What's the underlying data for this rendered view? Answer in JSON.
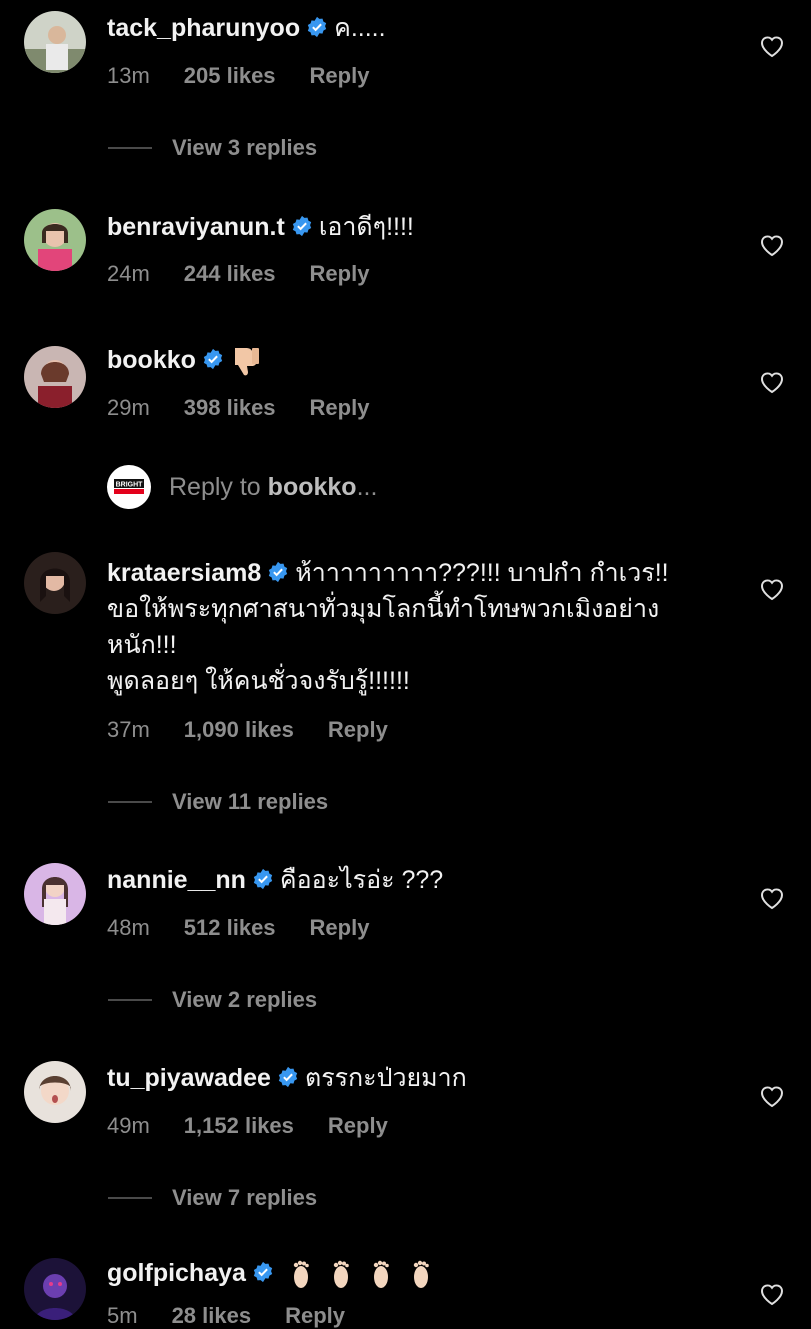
{
  "colors": {
    "background": "#000000",
    "text": "#f2f2f2",
    "muted": "#8e8e8e",
    "verified": "#3897f0"
  },
  "comments": [
    {
      "username": "tack_pharunyoo",
      "text": "ค.....",
      "time": "13m",
      "likes": "205 likes",
      "reply": "Reply",
      "view_replies": "View 3 replies"
    },
    {
      "username": "benraviyanun.t",
      "text": "เอาดีๆ!!!!",
      "time": "24m",
      "likes": "244 likes",
      "reply": "Reply"
    },
    {
      "username": "bookko",
      "text": "",
      "emoji_icon": "thumbs-down-icon",
      "time": "29m",
      "likes": "398 likes",
      "reply": "Reply"
    },
    {
      "username": "krataersiam8",
      "text_line1": "ห้าาาาาาาาา???!!! บาปกำ กำเวร!!",
      "text_line2": "ขอให้พระทุกศาสนาทั่วมุมโลกนี้ทำโทษพวกเมิงอย่าง",
      "text_line3": "หนัก!!!",
      "text_line4": "พูดลอยๆ ให้คนชั่วจงรับรู้!!!!!!",
      "time": "37m",
      "likes": "1,090 likes",
      "reply": "Reply",
      "view_replies": "View 11 replies"
    },
    {
      "username": "nannie__nn",
      "text": "คืออะไรอ่ะ ???",
      "time": "48m",
      "likes": "512 likes",
      "reply": "Reply",
      "view_replies": "View 2 replies"
    },
    {
      "username": "tu_piyawadee",
      "text": "ตรรกะป่วยมาก",
      "time": "49m",
      "likes": "1,152 likes",
      "reply": "Reply",
      "view_replies": "View 7 replies"
    },
    {
      "username": "golfpichaya",
      "text": "",
      "emoji_icon": "foot-icon",
      "time": "5m",
      "likes": "28 likes",
      "reply": "Reply"
    }
  ],
  "reply_to": {
    "prefix": "Reply to ",
    "username": "bookko",
    "suffix": "...",
    "logo_text": "BRIGHT"
  }
}
